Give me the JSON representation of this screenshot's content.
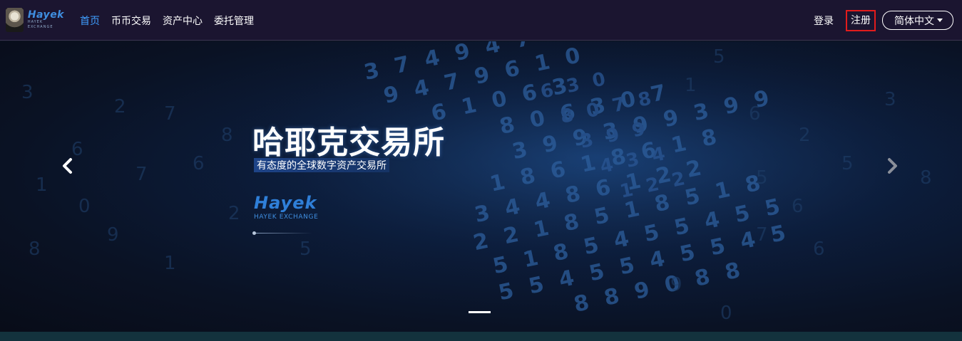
{
  "header": {
    "logo": {
      "word": "Hayek",
      "sub": "HAYEK EXCHANGE"
    },
    "nav": [
      {
        "label": "首页",
        "active": true
      },
      {
        "label": "币币交易",
        "active": false
      },
      {
        "label": "资产中心",
        "active": false
      },
      {
        "label": "委托管理",
        "active": false
      }
    ],
    "login_label": "登录",
    "register_label": "注册",
    "language_label": "简体中文"
  },
  "hero": {
    "title": "哈耶克交易所",
    "subtitle": "有态度的全球数字资产交易所",
    "brand_word": "Hayek",
    "brand_sub": "HAYEK EXCHANGE",
    "slide_indicator": {
      "current": 1
    }
  },
  "colors": {
    "nav_bg": "#1b1530",
    "active_link": "#3f9eff",
    "register_border": "#e21c1c",
    "brand_blue": "#2f7fd8",
    "hero_bg": "#0c1d3c"
  },
  "icons": {
    "prev": "chevron-left-icon",
    "next": "chevron-right-icon",
    "lang": "caret-down-icon"
  }
}
